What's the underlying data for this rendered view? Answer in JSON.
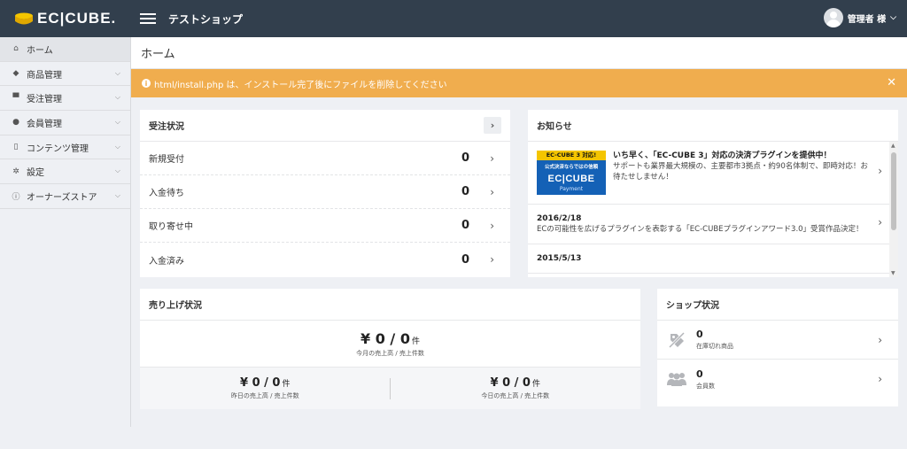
{
  "header": {
    "logo_text": "EC|CUBE.",
    "shop_name": "テストショップ",
    "user_label": "管理者 様"
  },
  "sidebar": {
    "items": [
      {
        "label": "ホーム",
        "icon": "home-icon"
      },
      {
        "label": "商品管理",
        "icon": "tag-icon"
      },
      {
        "label": "受注管理",
        "icon": "cart-icon"
      },
      {
        "label": "会員管理",
        "icon": "users-icon"
      },
      {
        "label": "コンテンツ管理",
        "icon": "file-icon"
      },
      {
        "label": "設定",
        "icon": "gear-icon"
      },
      {
        "label": "オーナーズストア",
        "icon": "info-icon"
      }
    ]
  },
  "page": {
    "title": "ホーム"
  },
  "alert": {
    "message": "html/install.php は、インストール完了後にファイルを削除してください"
  },
  "orders": {
    "title": "受注状況",
    "rows": [
      {
        "label": "新規受付",
        "count": "0"
      },
      {
        "label": "入金待ち",
        "count": "0"
      },
      {
        "label": "取り寄せ中",
        "count": "0"
      },
      {
        "label": "入金済み",
        "count": "0"
      }
    ]
  },
  "news": {
    "title": "お知らせ",
    "banner": {
      "top": "EC-CUBE 3 対応!",
      "middle": "公式決済ならではの信頼",
      "logo": "EC|CUBE",
      "sub": "Payment"
    },
    "items": [
      {
        "title": "いち早く、「EC-CUBE 3」対応の決済プラグインを提供中！",
        "body": "サポートも業界最大規模の、主要都市3拠点・約90名体制で、即時対応！お待たせしません！"
      },
      {
        "title": "2016/2/18",
        "body": "ECの可能性を広げるプラグインを表彰する「EC-CUBEプラグインアワード3.0」受賞作品決定！"
      },
      {
        "title": "2015/5/13",
        "body": ""
      }
    ]
  },
  "sales": {
    "title": "売り上げ状況",
    "month": {
      "amount": "¥ 0 / 0",
      "unit": "件",
      "label": "今月の売上高 / 売上件数"
    },
    "yesterday": {
      "amount": "¥ 0 / 0",
      "unit": "件",
      "label": "昨日の売上高 / 売上件数"
    },
    "today": {
      "amount": "¥ 0 / 0",
      "unit": "件",
      "label": "今日の売上高 / 売上件数"
    }
  },
  "shop": {
    "title": "ショップ状況",
    "rows": [
      {
        "value": "0",
        "label": "在庫切れ商品",
        "icon": "tag-slash-icon"
      },
      {
        "value": "0",
        "label": "会員数",
        "icon": "users-icon"
      }
    ]
  }
}
